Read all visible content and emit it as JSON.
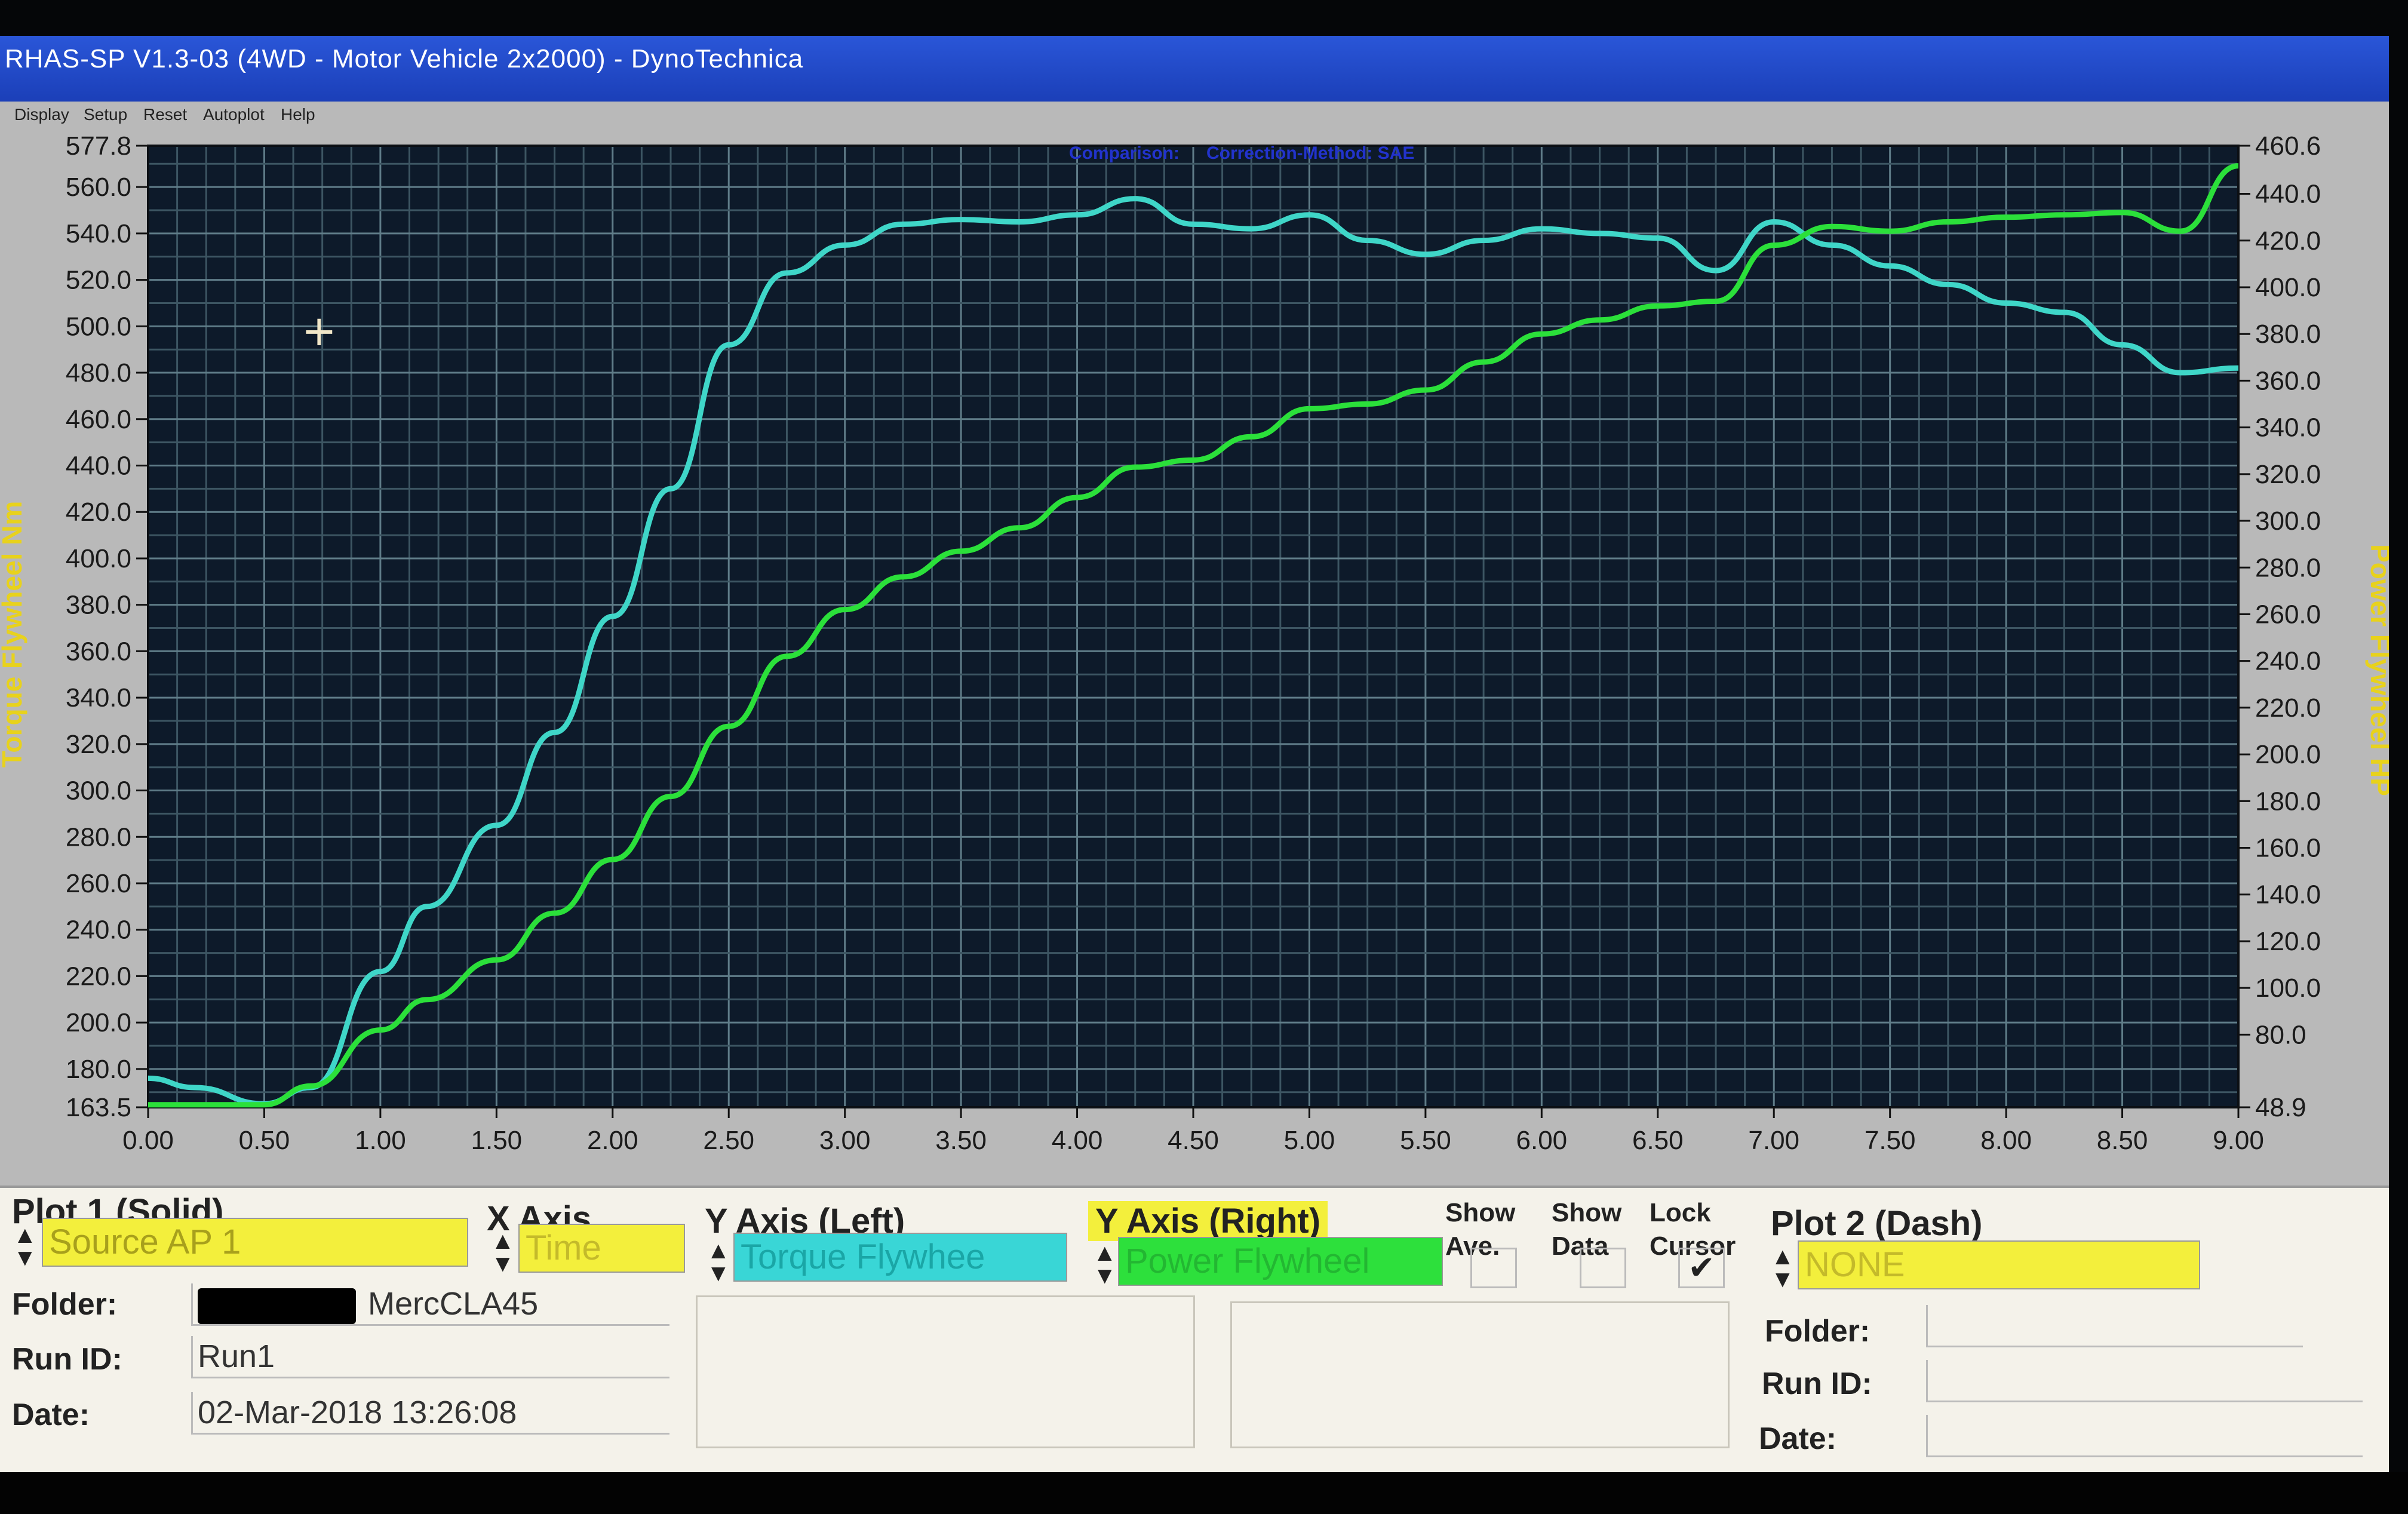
{
  "window": {
    "title": "RHAS-SP V1.3-03  (4WD - Motor Vehicle 2x2000) - DynoTechnica"
  },
  "menu": [
    "Display",
    "Setup",
    "Reset",
    "Autoplot",
    "Help"
  ],
  "chart_header": {
    "comparison": "Comparison:",
    "correction": "Correction-Method: SAE"
  },
  "chart_data": {
    "type": "line",
    "xlabel": "",
    "ylabel_left": "Torque Flywheel Nm",
    "ylabel_right": "Power Flywheel HP",
    "xlim": [
      0,
      9
    ],
    "ylim_left": [
      163.5,
      577.8
    ],
    "ylim_right": [
      48.9,
      460.6
    ],
    "grid": true,
    "x_ticks": [
      "0.00",
      "0.50",
      "1.00",
      "1.50",
      "2.00",
      "2.50",
      "3.00",
      "3.50",
      "4.00",
      "4.50",
      "5.00",
      "5.50",
      "6.00",
      "6.50",
      "7.00",
      "7.50",
      "8.00",
      "8.50",
      "9.00"
    ],
    "y_left_ticks": [
      "577.8",
      "560.0",
      "540.0",
      "520.0",
      "500.0",
      "480.0",
      "460.0",
      "440.0",
      "420.0",
      "400.0",
      "380.0",
      "360.0",
      "340.0",
      "320.0",
      "300.0",
      "280.0",
      "260.0",
      "240.0",
      "220.0",
      "200.0",
      "180.0",
      "163.5"
    ],
    "y_right_ticks": [
      "460.6",
      "440.0",
      "420.0",
      "400.0",
      "380.0",
      "360.0",
      "340.0",
      "320.0",
      "300.0",
      "280.0",
      "260.0",
      "240.0",
      "220.0",
      "200.0",
      "180.0",
      "160.0",
      "140.0",
      "120.0",
      "100.0",
      "80.0",
      "48.9"
    ],
    "series": [
      {
        "name": "Torque Flywheel",
        "axis": "left",
        "color": "#3fd6c8",
        "x": [
          0,
          0.2,
          0.5,
          0.7,
          1.0,
          1.2,
          1.5,
          1.75,
          2.0,
          2.25,
          2.5,
          2.75,
          3.0,
          3.25,
          3.5,
          3.75,
          4.0,
          4.25,
          4.5,
          4.75,
          5.0,
          5.25,
          5.5,
          5.75,
          6.0,
          6.25,
          6.5,
          6.75,
          7.0,
          7.25,
          7.5,
          7.75,
          8.0,
          8.25,
          8.5,
          8.75,
          9.0
        ],
        "y": [
          176,
          172,
          165,
          172,
          222,
          250,
          285,
          325,
          375,
          430,
          492,
          523,
          535,
          544,
          546,
          545,
          548,
          555,
          544,
          542,
          548,
          537,
          531,
          537,
          542,
          540,
          538,
          524,
          545,
          535,
          526,
          518,
          510,
          506,
          492,
          480,
          482
        ]
      },
      {
        "name": "Power Flywheel",
        "axis": "right",
        "color": "#2be03a",
        "x": [
          0,
          0.2,
          0.5,
          0.7,
          1.0,
          1.2,
          1.5,
          1.75,
          2.0,
          2.25,
          2.5,
          2.75,
          3.0,
          3.25,
          3.5,
          3.75,
          4.0,
          4.25,
          4.5,
          4.75,
          5.0,
          5.25,
          5.5,
          5.75,
          6.0,
          6.25,
          6.5,
          6.75,
          7.0,
          7.25,
          7.5,
          7.75,
          8.0,
          8.25,
          8.5,
          8.75,
          9.0
        ],
        "y": [
          50,
          50,
          50,
          58,
          82,
          95,
          112,
          132,
          155,
          182,
          212,
          242,
          262,
          276,
          287,
          297,
          310,
          323,
          326,
          336,
          348,
          350,
          356,
          368,
          380,
          386,
          392,
          394,
          418,
          426,
          424,
          428,
          430,
          431,
          432,
          424,
          452
        ]
      }
    ]
  },
  "panel": {
    "plot1": {
      "title": "Plot 1 (Solid)",
      "source": "Source AP 1",
      "folder_label": "Folder:",
      "folder": "MercCLA45",
      "runid_label": "Run ID:",
      "runid": "Run1",
      "date_label": "Date:",
      "date": "02-Mar-2018  13:26:08"
    },
    "x_axis": {
      "title": "X Axis",
      "value": "Time",
      "color": "#f6f23a"
    },
    "y_left": {
      "title": "Y Axis (Left)",
      "value": "Torque Flywhee",
      "color": "#37d8d6"
    },
    "y_right": {
      "title": "Y Axis (Right)",
      "value": "Power Flywheel",
      "color": "#2de03c"
    },
    "show_ave": "Show Ave.",
    "show_data": "Show Data",
    "lock_cursor": "Lock Cursor",
    "check_mark": "✔",
    "plot2": {
      "title": "Plot 2 (Dash)",
      "source": "NONE",
      "folder_label": "Folder:",
      "runid_label": "Run ID:",
      "date_label": "Date:"
    }
  }
}
